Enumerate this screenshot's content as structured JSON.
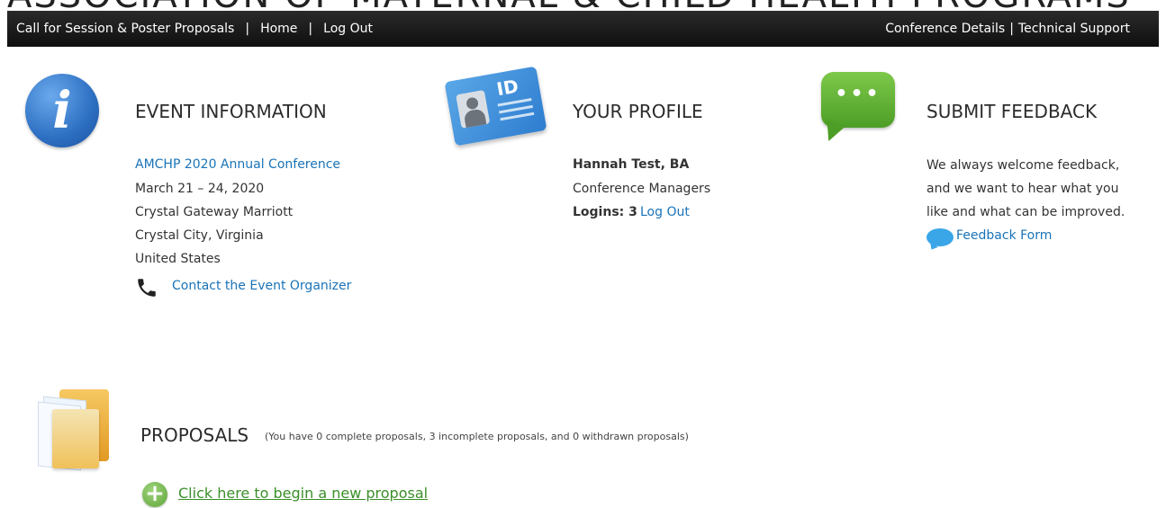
{
  "header": {
    "banner_text": "ASSOCIATION OF MATERNAL & CHILD HEALTH PROGRAMS",
    "nav_left": [
      "Call for Session & Poster Proposals",
      "Home",
      "Log Out"
    ],
    "nav_right": [
      "Conference Details",
      "Technical Support"
    ]
  },
  "event_information": {
    "title": "EVENT INFORMATION",
    "event_name": "AMCHP 2020 Annual Conference",
    "dates": "March 21 – 24, 2020",
    "venue": "Crystal Gateway Marriott",
    "city": "Crystal City, Virginia",
    "country": "United States",
    "contact_link": "Contact the Event Organizer"
  },
  "your_profile": {
    "title": "YOUR PROFILE",
    "name": "Hannah Test, BA",
    "group": "Conference Managers",
    "logins_label": "Logins: 3",
    "logout_link": "Log Out",
    "id_badge_text": "ID"
  },
  "submit_feedback": {
    "title": "SUBMIT FEEDBACK",
    "lines": [
      "We always welcome feedback,",
      "and we want to hear what you",
      "like and what can be improved."
    ],
    "form_link": "Feedback Form",
    "dots": "•••"
  },
  "proposals": {
    "title": "PROPOSALS",
    "summary": "(You have 0 complete proposals, 3 incomplete proposals, and 0 withdrawn proposals)",
    "new_link": "Click here to begin a new proposal"
  },
  "icons": {
    "info": "info-icon",
    "profile": "id-card-icon",
    "feedback": "chat-bubble-icon",
    "proposals": "folder-icon",
    "phone": "phone-icon",
    "feedback_form": "speech-bubble-icon",
    "add": "plus-circle-icon"
  },
  "colors": {
    "link": "#1a73b8",
    "topbar": "#1a1a1a",
    "new_proposal_link": "#3b8f2a"
  }
}
